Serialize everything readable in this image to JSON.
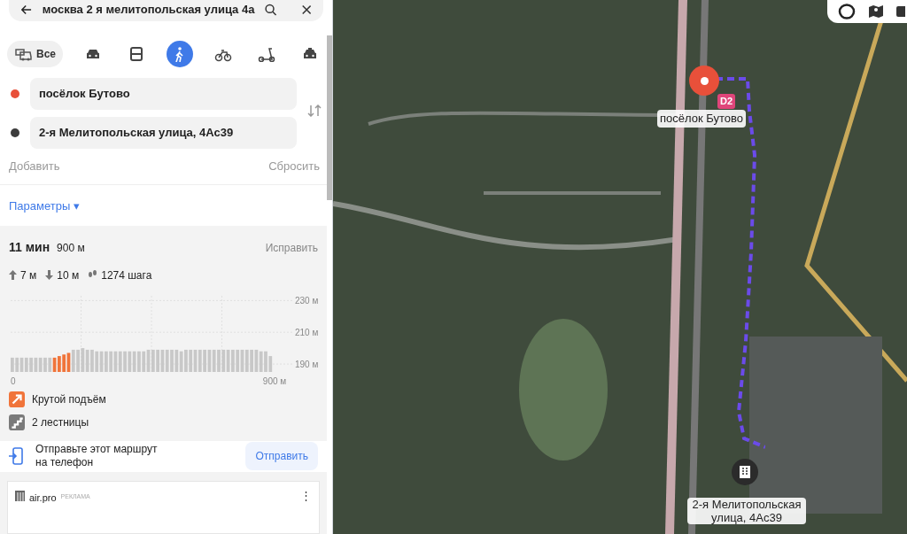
{
  "search": {
    "value": "москва 2 я мелитопольская улица 4а"
  },
  "modes": [
    {
      "kind": "all",
      "label": "Все",
      "selected": false
    },
    {
      "kind": "car",
      "selected": false
    },
    {
      "kind": "bus",
      "selected": false
    },
    {
      "kind": "walk",
      "selected": true
    },
    {
      "kind": "bike",
      "selected": false
    },
    {
      "kind": "scooter",
      "selected": false
    },
    {
      "kind": "taxi",
      "selected": false
    }
  ],
  "points": [
    {
      "value": "посёлок Бутово",
      "color": "#e8503a"
    },
    {
      "value": "2-я Мелитопольская улица, 4Ас39",
      "color": "#3c3c3c"
    }
  ],
  "add_label": "Добавить",
  "reset_label": "Сбросить",
  "params_label": "Параметры",
  "params_caret": "▾",
  "route": {
    "time": "11 мин",
    "distance": "900 м",
    "fix_label": "Исправить",
    "stats": [
      {
        "kind": "up",
        "text": "7 м"
      },
      {
        "kind": "down",
        "text": "10 м"
      },
      {
        "kind": "steps",
        "text": "1274 шага"
      }
    ],
    "chart_data": {
      "type": "bar",
      "x": [
        0,
        16,
        32,
        48,
        64,
        80,
        96,
        112,
        128,
        144,
        160,
        176,
        192,
        208,
        224,
        240,
        256,
        272,
        288,
        304,
        320,
        336,
        352,
        368,
        384,
        400,
        416,
        432,
        448,
        464,
        480,
        496,
        512,
        528,
        544,
        560,
        576,
        592,
        608,
        624,
        640,
        656,
        672,
        688,
        704,
        720,
        736,
        752,
        768,
        784,
        800,
        816,
        832,
        848,
        864,
        880
      ],
      "xlim": [
        0,
        900
      ],
      "series": [
        {
          "color": "#c8c8c8",
          "values": [
            194,
            194,
            194,
            194,
            194,
            194,
            194,
            194,
            194,
            null,
            null,
            null,
            null,
            199,
            199,
            200,
            199,
            199,
            198,
            198,
            198,
            198,
            198,
            198,
            198,
            198,
            198,
            198,
            198,
            199,
            199,
            199,
            199,
            199,
            199,
            199,
            198,
            199,
            199,
            199,
            199,
            199,
            199,
            199,
            199,
            199,
            199,
            199,
            199,
            199,
            199,
            199,
            199,
            198,
            198,
            195
          ]
        },
        {
          "color": "#f0743a",
          "values": [
            null,
            null,
            null,
            null,
            null,
            null,
            null,
            null,
            null,
            194,
            195,
            196,
            197,
            null,
            null,
            null,
            null,
            null,
            null,
            null,
            null,
            null,
            null,
            null,
            null,
            null,
            null,
            null,
            null,
            null,
            null,
            null,
            null,
            null,
            null,
            null,
            null,
            null,
            null,
            null,
            null,
            null,
            null,
            null,
            null,
            null,
            null,
            null,
            null,
            null,
            null,
            null,
            null,
            null,
            null,
            null
          ]
        }
      ],
      "ylim": [
        185,
        233
      ],
      "yticks": [
        {
          "value": 190,
          "label": "190 м"
        },
        {
          "value": 210,
          "label": "210 м"
        },
        {
          "value": 230,
          "label": "230 м"
        }
      ],
      "xticks": [
        {
          "value": 0,
          "label": "0"
        },
        {
          "value": 900,
          "label": "900 м"
        }
      ],
      "grid": true
    },
    "features": [
      {
        "kind": "climb",
        "text": "Крутой подъём",
        "color": "#f0743a"
      },
      {
        "kind": "stairs",
        "text": "2 лестницы",
        "color": "#7a7a7a"
      }
    ]
  },
  "send": {
    "text": "Отправьте этот маршрут на телефон",
    "button": "Отправить"
  },
  "ad": {
    "brand": "air.pro",
    "badge": "РЕКЛАМА",
    "menu": "⋮"
  },
  "map": {
    "start_label": "посёлок Бутово",
    "exit_badge": "D2",
    "end_label": "2-я Мелитопольская улица, 4Ас39"
  }
}
